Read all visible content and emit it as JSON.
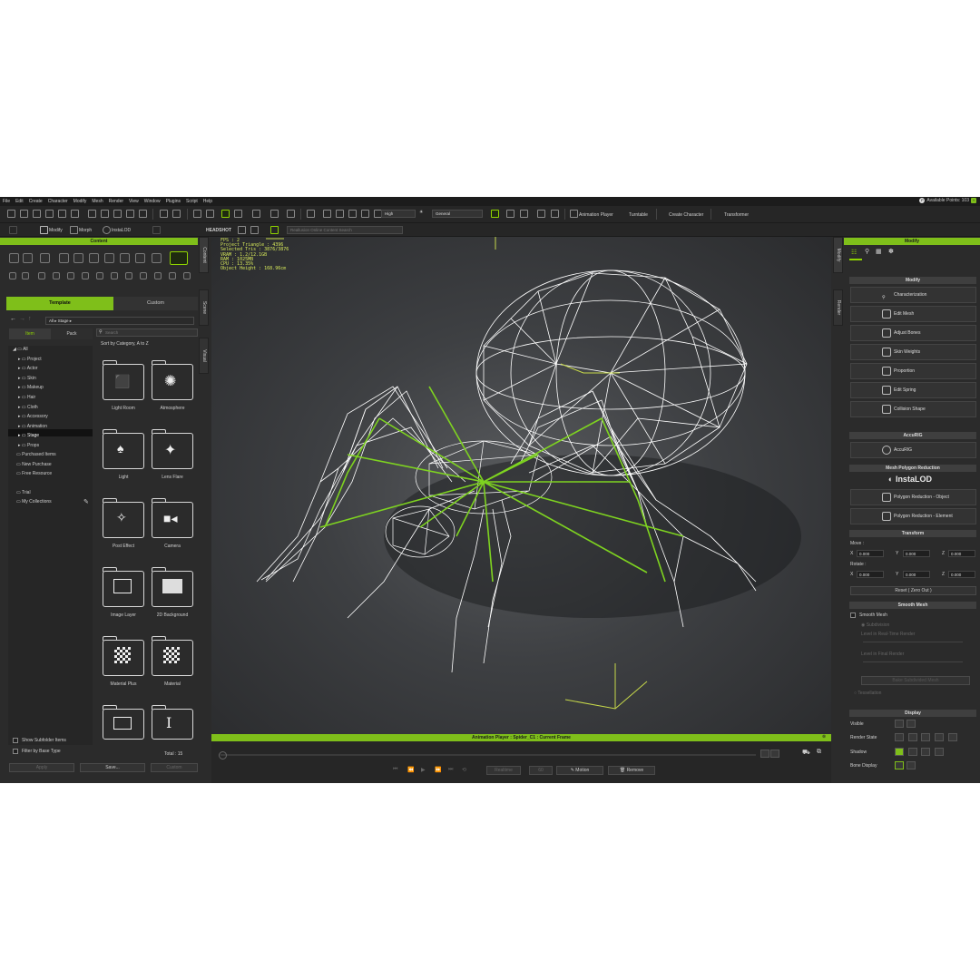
{
  "menu": [
    "File",
    "Edit",
    "Create",
    "Character",
    "Modify",
    "Mesh",
    "Render",
    "View",
    "Window",
    "Plugins",
    "Script",
    "Help"
  ],
  "points": {
    "label": "Available Points: 103"
  },
  "toolbar1": {
    "quality_dropdown": "High",
    "mode_dropdown": "General",
    "animation_player": "Animation Player",
    "turntable": "Turntable",
    "create_character": "Create Character",
    "transformer": "Transformer"
  },
  "toolbar2": {
    "modify": "Modify",
    "morph": "Morph",
    "instalod": "InstaLOD",
    "headshot": "HEADSHOT",
    "search_placeholder": "Reallusion Online Content Search"
  },
  "content": {
    "title": "Content",
    "tabs": [
      "Template",
      "Custom"
    ],
    "subtabs": [
      "Item",
      "Pack"
    ],
    "path": [
      "All",
      "Stage"
    ],
    "search_placeholder": "Search",
    "sort": "Sort by Category, A to Z",
    "tree": [
      "All",
      "Project",
      "Actor",
      "Skin",
      "Makeup",
      "Hair",
      "Cloth",
      "Accessory",
      "Animation",
      "Stage",
      "Props",
      "Purchased Items",
      "New Purchase",
      "Free Resource",
      "Trial",
      "My Collections"
    ],
    "thumbs": [
      "Light Room",
      "Atmosphere",
      "Light",
      "Lens Flare",
      "Post Effect",
      "Camera",
      "Image Layer",
      "2D Background",
      "Material Plus",
      "Material"
    ],
    "show_subfolder": "Show Subfolder Items",
    "filter_base": "Filter by Base Type",
    "total": "Total : 15",
    "buttons": [
      "Apply",
      "Save...",
      "Custom"
    ]
  },
  "side_tabs": {
    "left": [
      "Content",
      "Scene",
      "Visual"
    ],
    "right": [
      "Modify",
      "Render"
    ]
  },
  "viewport": {
    "stats": [
      "FPS : 2",
      "Project Triangle : 4396",
      "Selected Tris : 3876/3876",
      "VRAM : 1.2/12.1GB",
      "RAM : 1025MB",
      "CPU : 13.35%",
      "Object Height : 168.96cm"
    ]
  },
  "animation_player": {
    "title": "Animation Player : Spider_C1 : Current Frame",
    "realtime": "Realtime",
    "fps": "60",
    "motion": "Motion",
    "remove": "Remove"
  },
  "modify": {
    "title": "Modify",
    "sections": {
      "modify": "Modify",
      "accurig": "AccuRIG",
      "reduction": "Mesh Polygon Reduction",
      "transform": "Transform",
      "smooth": "Smooth Mesh",
      "display": "Display"
    },
    "buttons": [
      "Characterization",
      "Edit Mesh",
      "Adjust Bones",
      "Skin Weights",
      "Proportion",
      "Edit Spring",
      "Collision Shape"
    ],
    "accurig_btn": "AccuRIG",
    "instalod": "InstaLOD",
    "reduction_buttons": [
      "Polygon Reduction - Object",
      "Polygon Reduction - Element"
    ],
    "move": "Move :",
    "rotate": "Rotate :",
    "axes": [
      "X",
      "Y",
      "Z"
    ],
    "move_vals": [
      "0.000",
      "0.000",
      "0.000"
    ],
    "rotate_vals": [
      "0.000",
      "0.000",
      "0.000"
    ],
    "reset": "Reset ( Zero Out )",
    "smooth_mesh": "Smooth Mesh",
    "smooth_opts": [
      "Subdivision",
      "Level in Real-Time Render",
      "Level in Final Render",
      "Bake Subdivided Mesh",
      "Tessellation"
    ],
    "display_rows": [
      "Visible",
      "Render State",
      "Shadow",
      "Bone Display"
    ]
  },
  "colors": {
    "accent": "#7fbf1a",
    "bg": "#2b2b2b",
    "wire": "#ffffff",
    "bone": "#7ed320"
  }
}
